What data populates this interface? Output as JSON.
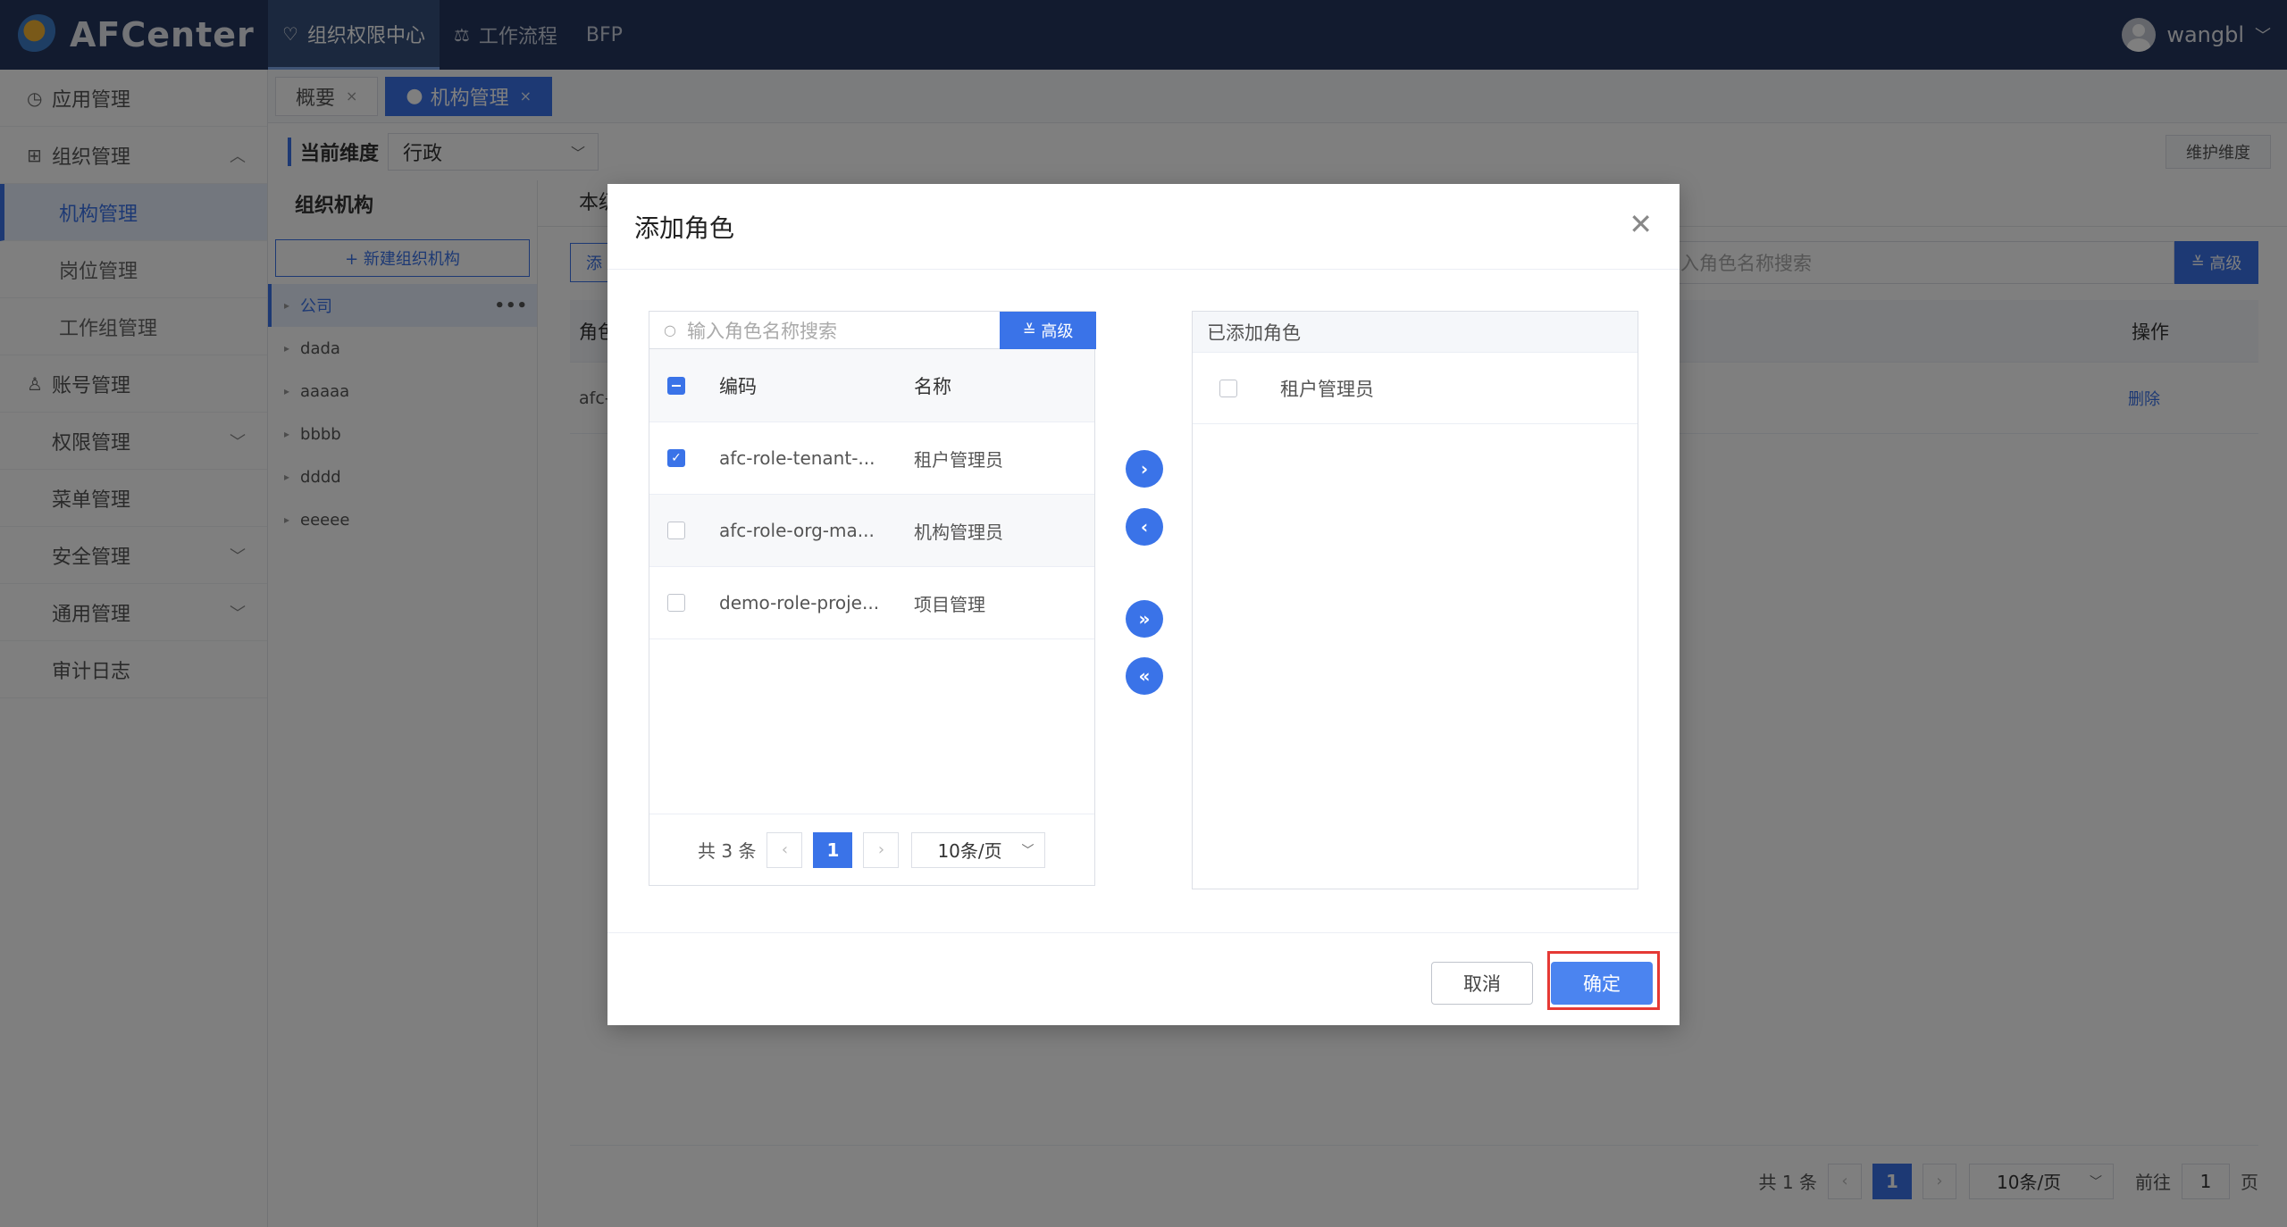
{
  "app": {
    "title": "AFCenter"
  },
  "topnav": [
    {
      "label": "组织权限中心",
      "icon": "shield-heart-icon",
      "active": true
    },
    {
      "label": "工作流程",
      "icon": "flow-icon",
      "active": false
    },
    {
      "label": "BFP",
      "icon": "",
      "active": false
    }
  ],
  "user": {
    "name": "wangbl"
  },
  "sidebar": {
    "items": [
      {
        "label": "应用管理",
        "icon": "clock-icon"
      },
      {
        "label": "组织管理",
        "icon": "grid-icon",
        "arrow": "up"
      },
      {
        "label": "机构管理",
        "sub": true,
        "active": true
      },
      {
        "label": "岗位管理",
        "sub": true
      },
      {
        "label": "工作组管理",
        "sub": true
      },
      {
        "label": "账号管理",
        "icon": "user-icon"
      },
      {
        "label": "权限管理",
        "arrow": "down"
      },
      {
        "label": "菜单管理"
      },
      {
        "label": "安全管理",
        "arrow": "down"
      },
      {
        "label": "通用管理",
        "arrow": "down"
      },
      {
        "label": "审计日志"
      }
    ]
  },
  "tabs": [
    {
      "label": "概要",
      "active": false
    },
    {
      "label": "机构管理",
      "active": true
    }
  ],
  "dimension": {
    "label": "当前维度",
    "value": "行政",
    "maintain_label": "维护维度"
  },
  "org": {
    "title": "组织机构",
    "new_button": "+ 新建组织机构",
    "nodes": [
      "公司",
      "dada",
      "aaaaa",
      "bbbb",
      "dddd",
      "eeeee"
    ]
  },
  "main": {
    "tab_label": "本级",
    "add_label": "添",
    "search_placeholder": "入角色名称搜索",
    "adv_label": "高级",
    "col_role": "角色",
    "col_op": "操作",
    "row_code": "afc-",
    "row_del": "删除",
    "pager": {
      "total": "共 1 条",
      "page": "1",
      "size": "10条/页",
      "goto": "前往",
      "goto_value": "1",
      "unit": "页"
    }
  },
  "modal": {
    "title": "添加角色",
    "search_placeholder": "输入角色名称搜索",
    "adv_label": "高级",
    "col_code": "编码",
    "col_name": "名称",
    "rows": [
      {
        "code": "afc-role-tenant-...",
        "name": "租户管理员",
        "checked": true
      },
      {
        "code": "afc-role-org-ma...",
        "name": "机构管理员",
        "checked": false
      },
      {
        "code": "demo-role-proje...",
        "name": "项目管理",
        "checked": false
      }
    ],
    "pager": {
      "total": "共 3 条",
      "page": "1",
      "size": "10条/页"
    },
    "added_title": "已添加角色",
    "added": [
      {
        "name": "租户管理员"
      }
    ],
    "cancel": "取消",
    "ok": "确定"
  }
}
